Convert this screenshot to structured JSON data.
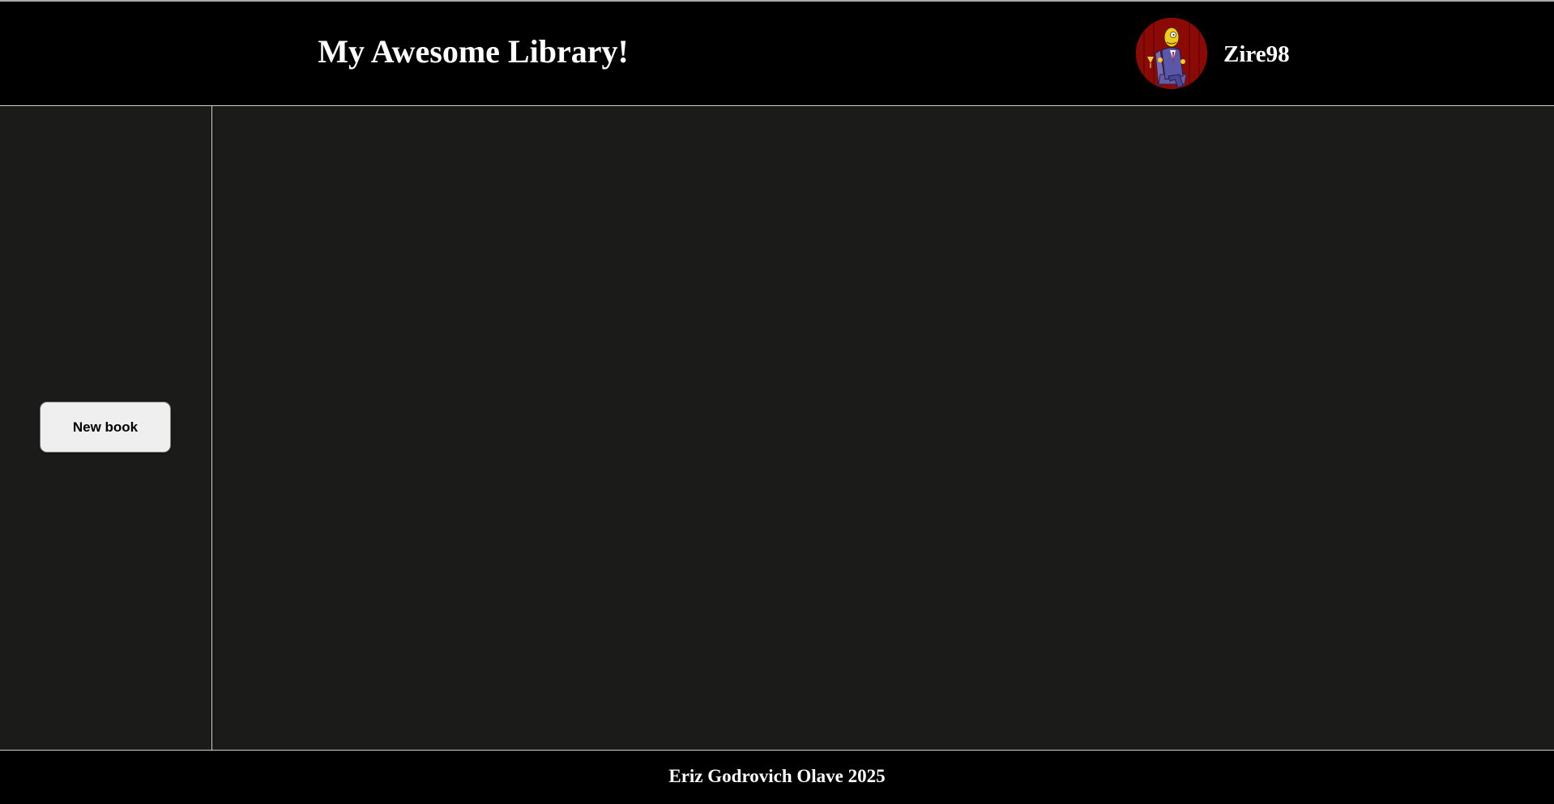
{
  "header": {
    "title": "My Awesome Library!",
    "username": "Zire98",
    "avatar_icon": "user-avatar-cartoon-man-in-chair"
  },
  "sidebar": {
    "new_book_label": "New book"
  },
  "footer": {
    "text": "Eriz Godrovich Olave 2025"
  },
  "colors": {
    "header_bg": "#000000",
    "content_bg": "#1b1b1a",
    "text": "#ffffff",
    "button_bg": "#efefef",
    "avatar_bg": "#8b0a05"
  }
}
